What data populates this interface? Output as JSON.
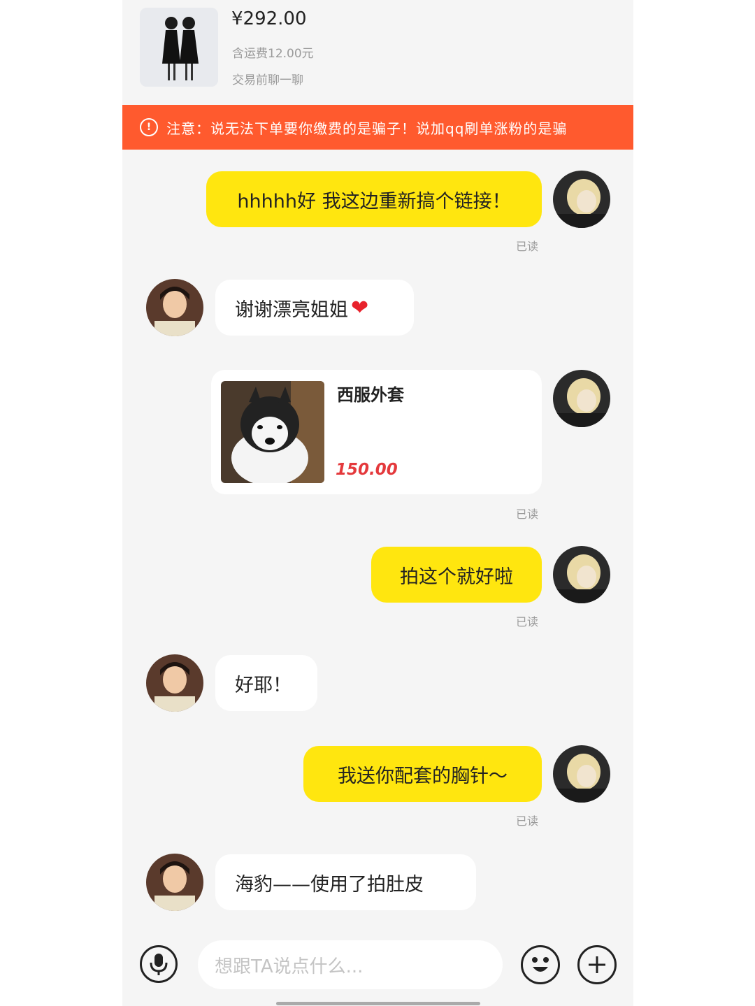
{
  "product": {
    "price": "¥292.00",
    "shipping": "含运费12.00元",
    "chat_before_trade": "交易前聊一聊"
  },
  "warning": {
    "text": "注意：说无法下单要你缴费的是骗子！说加qq刷单涨粉的是骗"
  },
  "messages": [
    {
      "from": "me",
      "text": "hhhhh好 我这边重新搞个链接！",
      "status": "已读"
    },
    {
      "from": "them",
      "text": "谢谢漂亮姐姐",
      "emoji": "❤"
    },
    {
      "from": "me",
      "type": "product_card",
      "title": "西服外套",
      "price": "150.00",
      "status": "已读"
    },
    {
      "from": "me",
      "text": "拍这个就好啦",
      "status": "已读"
    },
    {
      "from": "them",
      "text": "好耶！"
    },
    {
      "from": "me",
      "text": "我送你配套的胸针～",
      "status": "已读"
    },
    {
      "from": "them",
      "text": "海豹——使用了拍肚皮"
    }
  ],
  "input": {
    "placeholder": "想跟TA说点什么..."
  },
  "colors": {
    "my_bubble": "#ffe60f",
    "their_bubble": "#ffffff",
    "warning_bar": "#ff5a2e",
    "price_red": "#e4393c",
    "background": "#f5f5f5"
  },
  "icons": [
    "alert-circle-icon",
    "microphone-icon",
    "emoji-icon",
    "plus-icon"
  ]
}
